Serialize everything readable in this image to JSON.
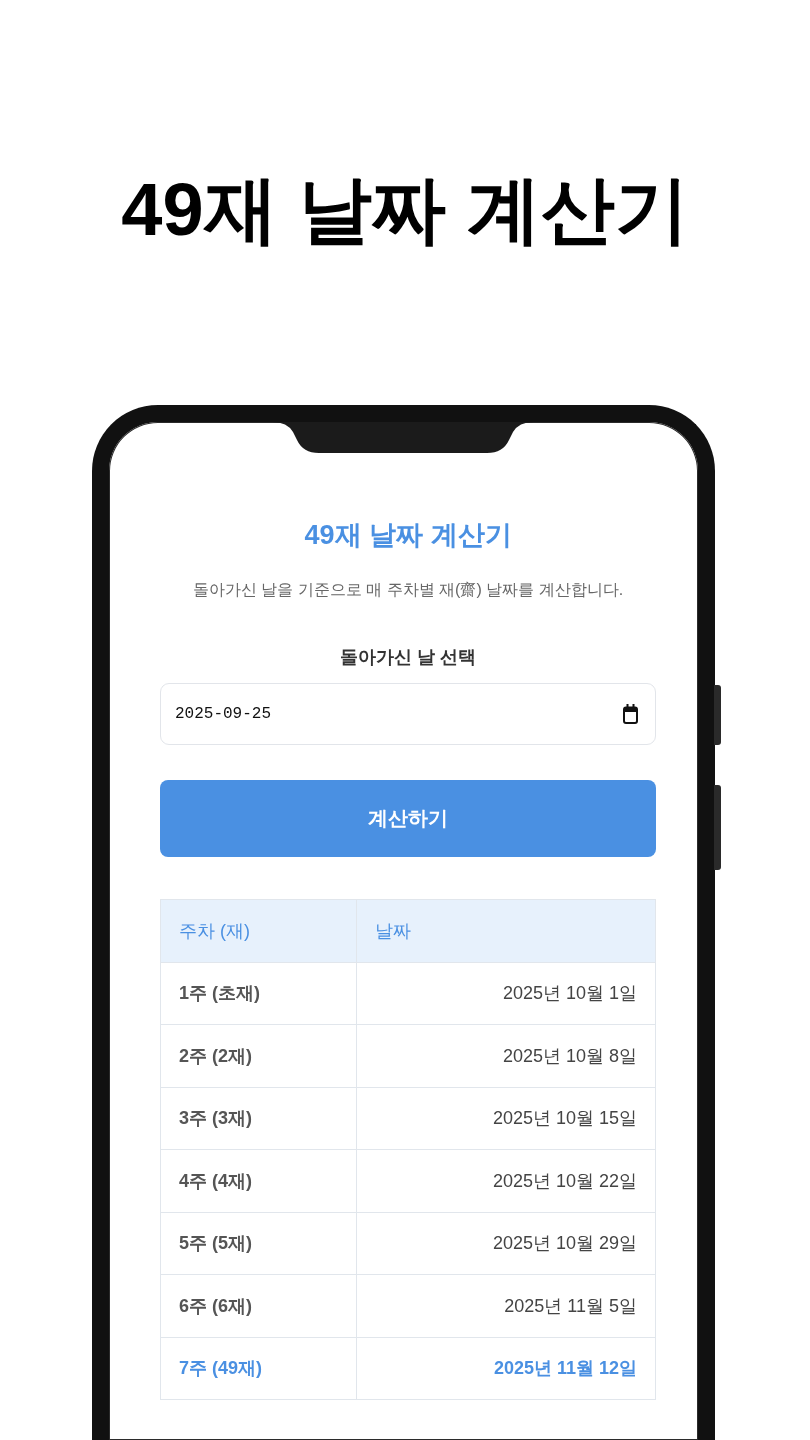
{
  "page_title": "49재 날짜 계산기",
  "app": {
    "title": "49재 날짜 계산기",
    "subtitle": "돌아가신 날을 기준으로 매 주차별 재(齋) 날짜를 계산합니다.",
    "date_label": "돌아가신 날 선택",
    "date_field": {
      "value": "2025-09-25"
    },
    "button": "계산하기"
  },
  "table": {
    "columns": [
      "주차 (재)",
      "날짜"
    ],
    "rows": [
      {
        "week": "1주 (초재)",
        "date": "2025년 10월 1일",
        "highlighted": false
      },
      {
        "week": "2주 (2재)",
        "date": "2025년 10월 8일",
        "highlighted": false
      },
      {
        "week": "3주 (3재)",
        "date": "2025년 10월 15일",
        "highlighted": false
      },
      {
        "week": "4주 (4재)",
        "date": "2025년 10월 22일",
        "highlighted": false
      },
      {
        "week": "5주 (5재)",
        "date": "2025년 10월 29일",
        "highlighted": false
      },
      {
        "week": "6주 (6재)",
        "date": "2025년 11월 5일",
        "highlighted": false
      },
      {
        "week": "7주 (49재)",
        "date": "2025년 11월 12일",
        "highlighted": true
      }
    ]
  }
}
